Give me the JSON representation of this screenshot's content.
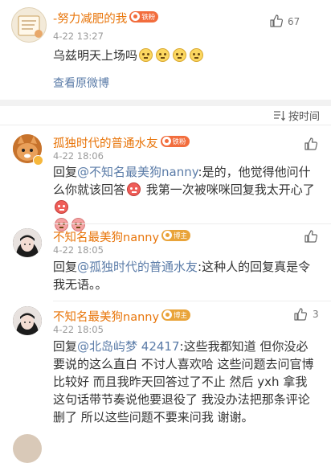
{
  "post": {
    "username": "-努力减肥的我",
    "badge": "铁粉",
    "time": "4-22 13:27",
    "like_count": "67",
    "text": "乌兹明天上场吗",
    "link_label": "查看原微博"
  },
  "sort": {
    "label": "按时间"
  },
  "comments": [
    {
      "username": "孤独时代的普通水友",
      "badge": "铁粉",
      "time": "4-22 18:06",
      "reply_prefix": "回复",
      "mention": "@不知名最美狗nanny",
      "text_a": ":是的，他觉得他问什么你就该回答",
      "text_b": "我第一次被咪咪回复我太开心了",
      "like_count": ""
    },
    {
      "username": "不知名最美狗nanny",
      "badge": "博主",
      "time": "4-22 18:05",
      "reply_prefix": "回复",
      "mention": "@孤独时代的普通水友",
      "text": ":这种人的回复真是令我无语。。",
      "like_count": ""
    },
    {
      "username": "不知名最美狗nanny",
      "badge": "博主",
      "time": "4-22 18:05",
      "reply_prefix": "回复",
      "mention": "@北岛屿梦 42417",
      "text": ":这些我都知道 但你没必要说的这么直白 不讨人喜欢哈 这些问题去问官博比较好 而且我昨天回答过了不止 然后 yxh 拿我这句话带节奏说他要退役了 我没办法把那条评论删了 所以这些问题不要来问我 谢谢。",
      "like_count": "3"
    }
  ],
  "colors": {
    "username": "#e8750a",
    "mention": "#5b7ca8",
    "link": "#5b7ca8",
    "badge_fire": "#f26d3d",
    "badge_host": "#e9a43a"
  }
}
